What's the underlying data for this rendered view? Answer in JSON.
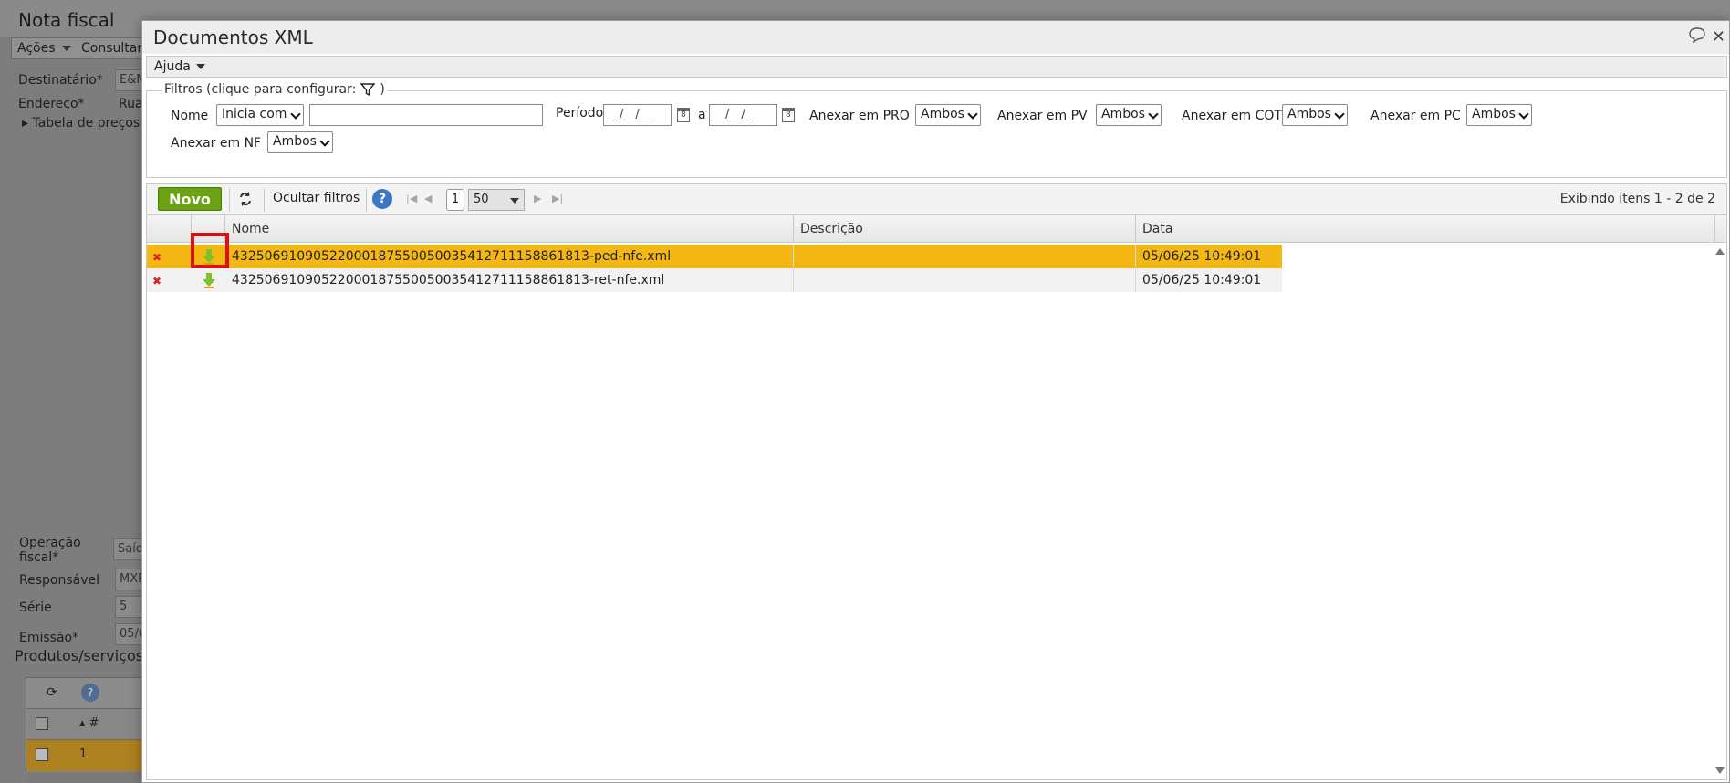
{
  "background": {
    "title": "Nota fiscal",
    "menu": {
      "acoes": "Ações",
      "consultar": "Consultar"
    },
    "labels": {
      "destinatario": "Destinatário*",
      "endereco": "Endereço*",
      "tabela_precos": "Tabela de preços",
      "operacao_fiscal": "Operação fiscal*",
      "responsavel": "Responsável",
      "serie": "Série",
      "emissao": "Emissão*",
      "produtos": "Produtos/serviços"
    },
    "values": {
      "destinatario": "E&M",
      "endereco": "Rua",
      "operacao_fiscal": "Saíd",
      "responsavel": "MXP",
      "serie": "5",
      "emissao": "05/0"
    },
    "grid": {
      "col_num": "#",
      "row_num": "1"
    }
  },
  "modal": {
    "title": "Documentos XML",
    "menu": {
      "ajuda": "Ajuda"
    },
    "filters": {
      "legend": "Filtros (clique para configurar:",
      "legend_close": ")",
      "nome_label": "Nome",
      "nome_mode": "Inicia com",
      "nome_value": "",
      "periodo_label": "Período",
      "periodo_from": "__/__/__",
      "periodo_sep": "a",
      "periodo_to": "__/__/__",
      "anexar_pro_label": "Anexar em PRO",
      "anexar_pro_value": "Ambos",
      "anexar_pv_label": "Anexar em PV",
      "anexar_pv_value": "Ambos",
      "anexar_cot_label": "Anexar em COT",
      "anexar_cot_value": "Ambos",
      "anexar_pc_label": "Anexar em PC",
      "anexar_pc_value": "Ambos",
      "anexar_nf_label": "Anexar em NF",
      "anexar_nf_value": "Ambos"
    },
    "toolbar": {
      "novo": "Novo",
      "ocultar_filtros": "Ocultar filtros",
      "page": "1",
      "page_size": "50",
      "info": "Exibindo itens 1 - 2 de 2"
    },
    "grid": {
      "columns": {
        "nome": "Nome",
        "descricao": "Descrição",
        "data": "Data"
      },
      "rows": [
        {
          "nome": "43250691090522000187550050035412711158861813-ped-nfe.xml",
          "descricao": "",
          "data": "05/06/25 10:49:01"
        },
        {
          "nome": "43250691090522000187550050035412711158861813-ret-nfe.xml",
          "descricao": "",
          "data": "05/06/25 10:49:01"
        }
      ]
    }
  },
  "colors": {
    "selected_row": "#f4b814",
    "novo_button": "#6aa312",
    "highlight": "#e01010",
    "help": "#3b78c4"
  }
}
